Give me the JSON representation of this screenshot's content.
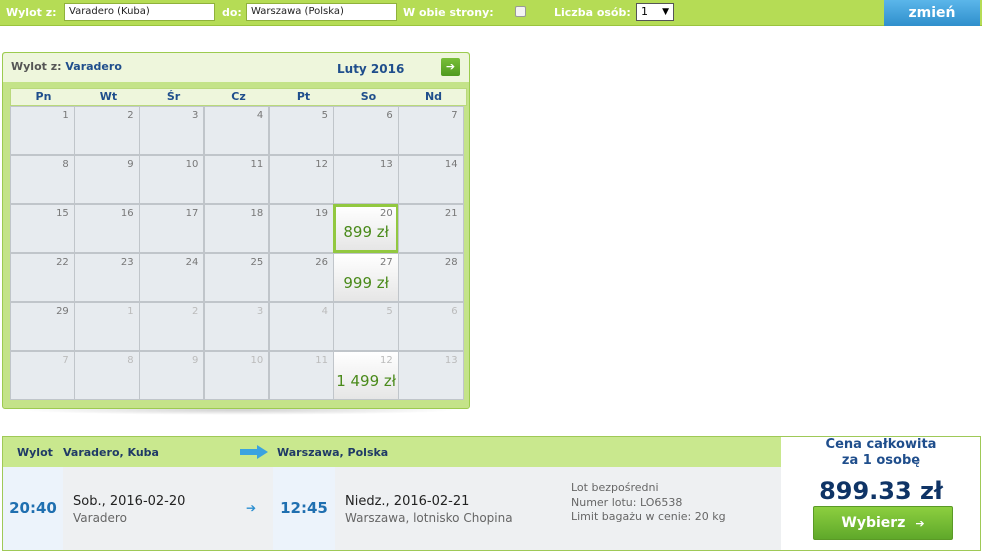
{
  "search": {
    "from_label": "Wylot z:",
    "from_value": "Varadero (Kuba)",
    "to_label": "do:",
    "to_value": "Warszawa (Polska)",
    "roundtrip_label": "W obie strony:",
    "roundtrip_checked": false,
    "persons_label": "Liczba osób:",
    "persons_value": "1",
    "persons_arrow": "▼",
    "change_button": "zmień"
  },
  "calendar": {
    "from_label": "Wylot z:",
    "from_city": "Varadero",
    "month": "Luty 2016",
    "next_icon": "arrow-right-icon",
    "next_glyph": "➔",
    "weekdays": [
      "Pn",
      "Wt",
      "Śr",
      "Cz",
      "Pt",
      "So",
      "Nd"
    ],
    "weeks": [
      [
        {
          "d": "1"
        },
        {
          "d": "2"
        },
        {
          "d": "3"
        },
        {
          "d": "4"
        },
        {
          "d": "5"
        },
        {
          "d": "6"
        },
        {
          "d": "7"
        }
      ],
      [
        {
          "d": "8"
        },
        {
          "d": "9"
        },
        {
          "d": "10"
        },
        {
          "d": "11"
        },
        {
          "d": "12"
        },
        {
          "d": "13"
        },
        {
          "d": "14"
        }
      ],
      [
        {
          "d": "15"
        },
        {
          "d": "16"
        },
        {
          "d": "17"
        },
        {
          "d": "18"
        },
        {
          "d": "19"
        },
        {
          "d": "20",
          "price": "899 zł",
          "selected": true
        },
        {
          "d": "21"
        }
      ],
      [
        {
          "d": "22"
        },
        {
          "d": "23"
        },
        {
          "d": "24"
        },
        {
          "d": "25"
        },
        {
          "d": "26"
        },
        {
          "d": "27",
          "price": "999 zł"
        },
        {
          "d": "28"
        }
      ],
      [
        {
          "d": "29"
        },
        {
          "d": "1",
          "other": true
        },
        {
          "d": "2",
          "other": true
        },
        {
          "d": "3",
          "other": true
        },
        {
          "d": "4",
          "other": true
        },
        {
          "d": "5",
          "other": true
        },
        {
          "d": "6",
          "other": true
        }
      ],
      [
        {
          "d": "7",
          "other": true
        },
        {
          "d": "8",
          "other": true
        },
        {
          "d": "9",
          "other": true
        },
        {
          "d": "10",
          "other": true
        },
        {
          "d": "11",
          "other": true
        },
        {
          "d": "12",
          "other": true,
          "price": "1 499 zł"
        },
        {
          "d": "13",
          "other": true
        }
      ]
    ]
  },
  "flight": {
    "header_label": "Wylot",
    "origin": "Varadero, Kuba",
    "destination": "Warszawa, Polska",
    "dep_time": "20:40",
    "dep_day": "Sob.",
    "dep_date": ", 2016-02-20",
    "dep_place": "Varadero",
    "mini_arrow": "➔",
    "arr_time": "12:45",
    "arr_day": "Niedz.",
    "arr_date": ", 2016-02-21",
    "arr_place": "Warszawa, lotnisko Chopina",
    "info_direct": "Lot bezpośredni",
    "info_flight_no": "Numer lotu: LO6538",
    "info_baggage": "Limit bagażu w cenie: 20 kg"
  },
  "price": {
    "label_line1": "Cena całkowita",
    "label_line2": "za 1 osobę",
    "value": "899.33 zł",
    "button": "Wybierz",
    "button_glyph": "➔"
  },
  "colors": {
    "bar_green": "#b5dc55",
    "header_green": "#c9e88e",
    "accent_blue": "#2f8fcc",
    "price_green": "#4a8a1a",
    "navy": "#1f4e8c"
  }
}
